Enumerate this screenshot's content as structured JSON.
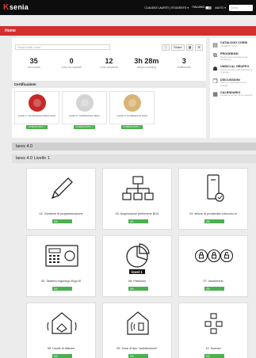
{
  "topbar": {
    "logo_k": "K",
    "logo_rest": "senia",
    "user_label": "CLAUDIO LAURITI | STUDENTE ▾",
    "language": "ITALIANO",
    "help": "AIUTO ▾",
    "search_placeholder": "Cerca"
  },
  "banner": {
    "title": "Home"
  },
  "panel": {
    "search_placeholder": "Cerca in tutti i corsi",
    "buttons": {
      "info": "ⓘ",
      "share": "Share",
      "grid": "▦",
      "list": "☰"
    },
    "stats": [
      {
        "value": "35",
        "label": "corsi iscritti"
      },
      {
        "value": "0",
        "label": "corsi non superati"
      },
      {
        "value": "12",
        "label": "corsi completati"
      },
      {
        "value": "3h 28m",
        "label": "tempo e-learning"
      },
      {
        "value": "3",
        "label": "certificazioni"
      }
    ],
    "certifications": {
      "header": "Certificazioni",
      "items": [
        {
          "name": "Livello 1. Certificazione Metronomic",
          "status": "COMPLETATO ✓",
          "color": "#c62828"
        },
        {
          "name": "Livello 2. Certificazione Silver",
          "status": "COMPLETATO ✓",
          "color": "#d4d4d4"
        },
        {
          "name": "Livello 3. Certificazione Gold",
          "status": "COMPLETATO ✓",
          "color": "#d9b477"
        }
      ]
    }
  },
  "sidebar": [
    {
      "title": "CATALOGO CORSI",
      "desc": "Visualizza i corsi",
      "icon": "catalog-icon"
    },
    {
      "title": "PROGRESSI",
      "desc": "Scopri come procede la tua formazione",
      "icon": "progress-icon"
    },
    {
      "title": "UNISCI AL GRUPPO",
      "desc": "Iscriviti ai corsi e alle discussioni di gruppo",
      "icon": "group-icon"
    },
    {
      "title": "DISCUSSIONI",
      "desc": "Vedi le conversazioni con i colleghi",
      "icon": "discussion-icon"
    },
    {
      "title": "CALENDARIO",
      "desc": "Visualizza eventi corsi e sessioni",
      "icon": "calendar-icon"
    }
  ],
  "course_group": "lares 4.0",
  "course_subgroup": "lares 4.0 Livello 1",
  "courses": [
    {
      "title": "02. Gestione di programmazione",
      "progress": "0%",
      "icon": "pencil-icon"
    },
    {
      "title": "03. Acquisizione periferiche BUS",
      "progress": "0%",
      "icon": "bus-tree-icon"
    },
    {
      "title": "04. lettore di prossimità volorvolo-in",
      "progress": "0%",
      "icon": "proximity-reader-icon"
    },
    {
      "title": "05. Tastiera ergonego Ergo M",
      "progress": "0%",
      "icon": "keypad-icon"
    },
    {
      "title": "06. Partizioni",
      "progress": "0%",
      "icon": "partitions-icon",
      "badge": "level 1"
    },
    {
      "title": "07. Inserimenti",
      "progress": "0%",
      "icon": "arming-icon"
    },
    {
      "title": "08. Uscite di allarme",
      "progress": "0%",
      "icon": "alarm-outputs-icon"
    },
    {
      "title": "09. Zone di tipo \"antintrusione\"",
      "progress": "0%",
      "icon": "intrusion-zones-icon"
    },
    {
      "title": "10. Scenari",
      "progress": "0%",
      "icon": "scenarios-icon"
    }
  ]
}
